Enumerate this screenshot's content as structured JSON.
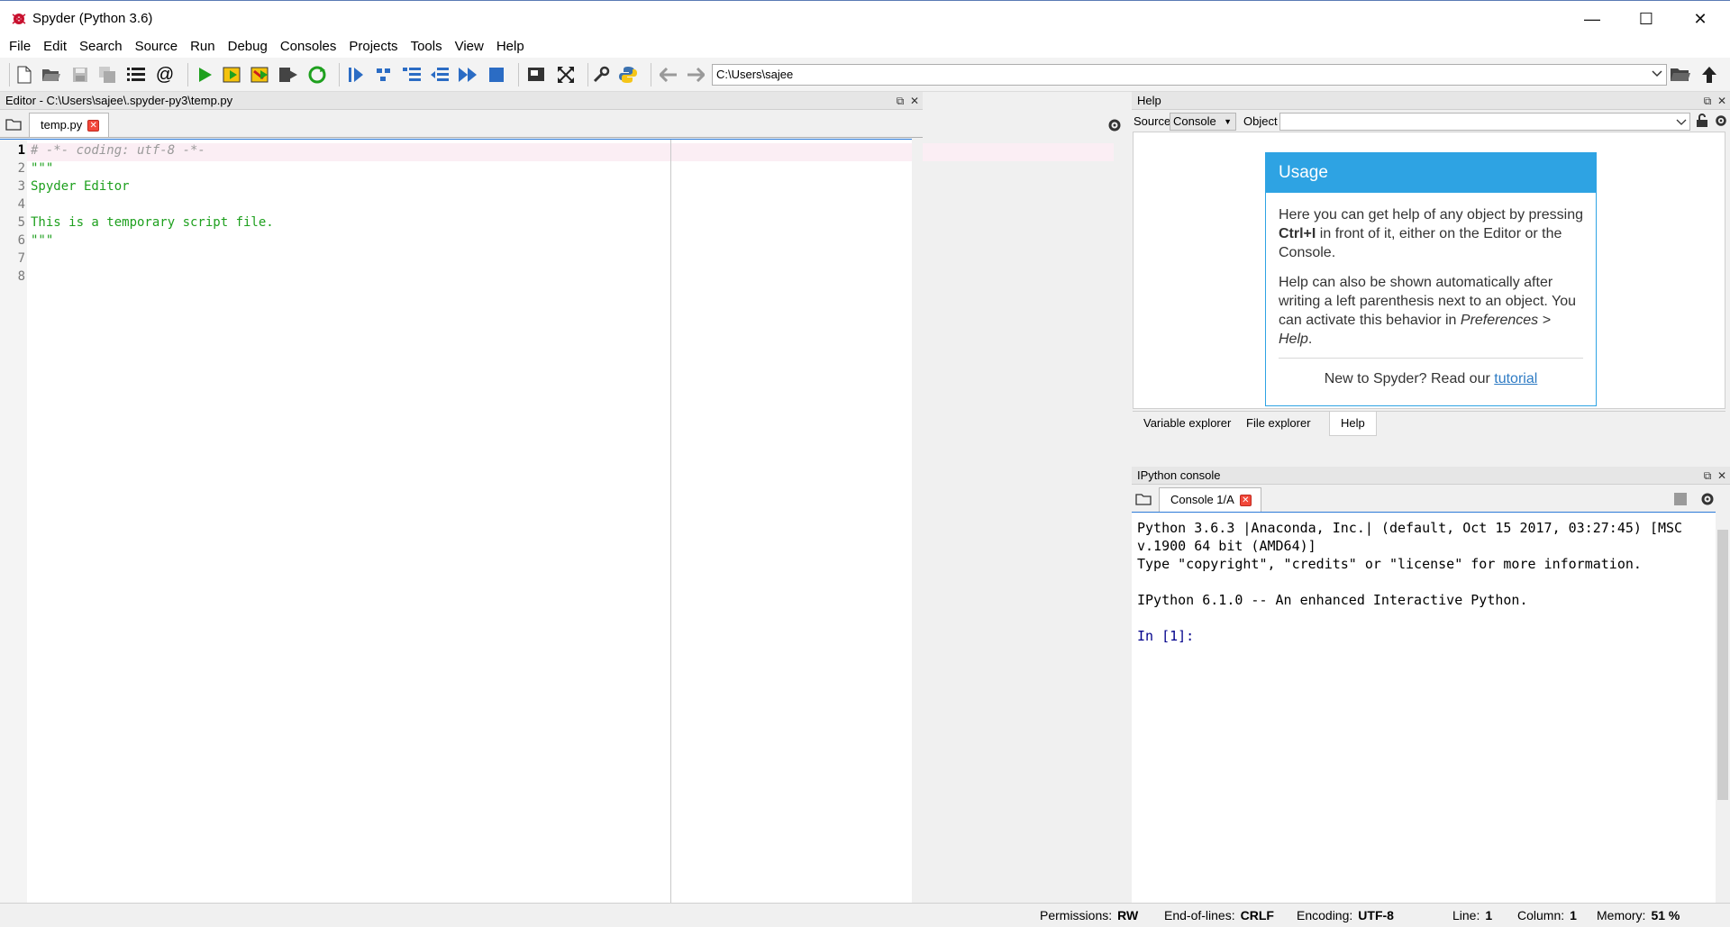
{
  "window": {
    "title": "Spyder (Python 3.6)",
    "minimize": "—",
    "maximize": "☐",
    "close": "✕"
  },
  "menu": [
    "File",
    "Edit",
    "Search",
    "Source",
    "Run",
    "Debug",
    "Consoles",
    "Projects",
    "Tools",
    "View",
    "Help"
  ],
  "toolbar": {
    "path": "C:\\Users\\sajee",
    "icons": [
      "new-file-icon",
      "open-file-icon",
      "save-icon",
      "save-all-icon",
      "outline-icon",
      "at-icon",
      "run-icon",
      "run-cell-icon",
      "run-cell-advance-icon",
      "run-selection-icon",
      "rerun-icon",
      "debug-icon",
      "step-icon",
      "step-into-icon",
      "step-return-icon",
      "continue-icon",
      "stop-icon",
      "maximize-pane-icon",
      "fullscreen-icon",
      "preferences-icon",
      "python-path-icon",
      "back-arrow-icon",
      "forward-arrow-icon",
      "browse-folder-icon",
      "parent-dir-icon"
    ],
    "accent_green": "#1ea01e",
    "accent_blue": "#2b6cc4"
  },
  "editor": {
    "header": "Editor - C:\\Users\\sajee\\.spyder-py3\\temp.py",
    "tab_label": "temp.py",
    "current_line_color": "#fbeef4",
    "lines": [
      {
        "n": "1",
        "text": "# -*- coding: utf-8 -*-",
        "kind": "comment"
      },
      {
        "n": "2",
        "text": "\"\"\"",
        "kind": "string"
      },
      {
        "n": "3",
        "text": "Spyder Editor",
        "kind": "string"
      },
      {
        "n": "4",
        "text": "",
        "kind": "string"
      },
      {
        "n": "5",
        "text": "This is a temporary script file.",
        "kind": "string"
      },
      {
        "n": "6",
        "text": "\"\"\"",
        "kind": "string"
      },
      {
        "n": "7",
        "text": "",
        "kind": "plain"
      },
      {
        "n": "8",
        "text": "",
        "kind": "plain"
      }
    ]
  },
  "help": {
    "header": "Help",
    "source_label": "Source",
    "source_value": "Console",
    "object_label": "Object",
    "usage_title": "Usage",
    "p1_a": "Here you can get help of any object by pressing ",
    "p1_bold": "Ctrl+I",
    "p1_b": " in front of it, either on the Editor or the Console.",
    "p2_a": "Help can also be shown automatically after writing a left parenthesis next to an object. You can activate this behavior in ",
    "p2_italic": "Preferences > Help",
    "p2_b": ".",
    "new_text": "New to Spyder? Read our ",
    "link": "tutorial",
    "tabs": [
      "Variable explorer",
      "File explorer",
      "Help"
    ]
  },
  "console": {
    "header": "IPython console",
    "tab_label": "Console 1/A",
    "lines": [
      "Python 3.6.3 |Anaconda, Inc.| (default, Oct 15 2017, 03:27:45) [MSC",
      "v.1900 64 bit (AMD64)]",
      "Type \"copyright\", \"credits\" or \"license\" for more information.",
      "",
      "IPython 6.1.0 -- An enhanced Interactive Python.",
      "",
      "In [1]:"
    ],
    "prompt_color": "#00008b"
  },
  "status": {
    "permissions_label": "Permissions:",
    "permissions_value": "RW",
    "eol_label": "End-of-lines:",
    "eol_value": "CRLF",
    "encoding_label": "Encoding:",
    "encoding_value": "UTF-8",
    "line_label": "Line:",
    "line_value": "1",
    "column_label": "Column:",
    "column_value": "1",
    "memory_label": "Memory:",
    "memory_value": "51 %"
  }
}
